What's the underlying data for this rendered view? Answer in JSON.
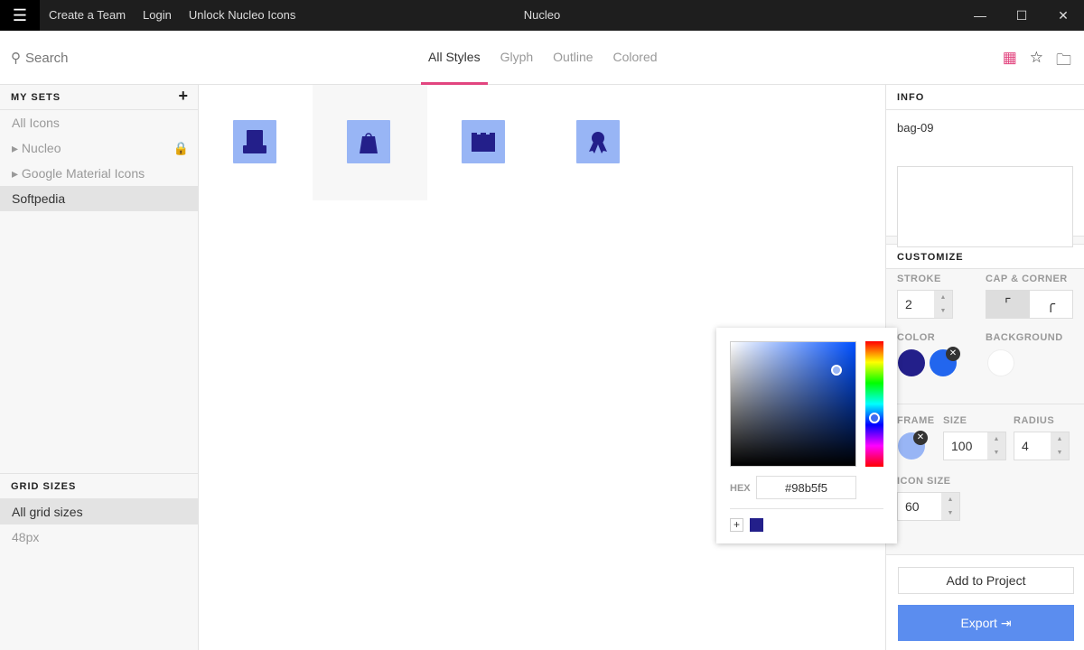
{
  "titlebar": {
    "title": "Nucleo",
    "links": [
      "Create a Team",
      "Login",
      "Unlock Nucleo Icons"
    ]
  },
  "search": {
    "placeholder": "Search"
  },
  "tabs": [
    "All Styles",
    "Glyph",
    "Outline",
    "Colored"
  ],
  "sidebar": {
    "my_sets": "MY SETS",
    "items": [
      "All Icons",
      "Nucleo",
      "Google Material Icons",
      "Softpedia"
    ],
    "grid_sizes": "GRID SIZES",
    "grid_items": [
      "All grid sizes",
      "48px"
    ]
  },
  "icons": [
    "hat",
    "bag-09",
    "castle",
    "award-ribbon"
  ],
  "info": {
    "title": "INFO",
    "name": "bag-09"
  },
  "customize": {
    "title": "CUSTOMIZE",
    "stroke_label": "STROKE",
    "stroke": "2",
    "cap_label": "CAP & CORNER",
    "color_label": "COLOR",
    "background_label": "BACKGROUND",
    "frame_label": "FRAME",
    "size_label": "SIZE",
    "size": "100",
    "radius_label": "RADIUS",
    "radius": "4",
    "icon_size_label": "ICON SIZE",
    "icon_size": "60"
  },
  "colors": {
    "primary": "#231f8a",
    "secondary": "#2266ee",
    "frame": "#98b5f5",
    "accent": "#e2457f",
    "export": "#5b8def"
  },
  "picker": {
    "hex_label": "HEX",
    "hex": "#98b5f5"
  },
  "actions": {
    "add": "Add to Project",
    "export": "Export"
  }
}
